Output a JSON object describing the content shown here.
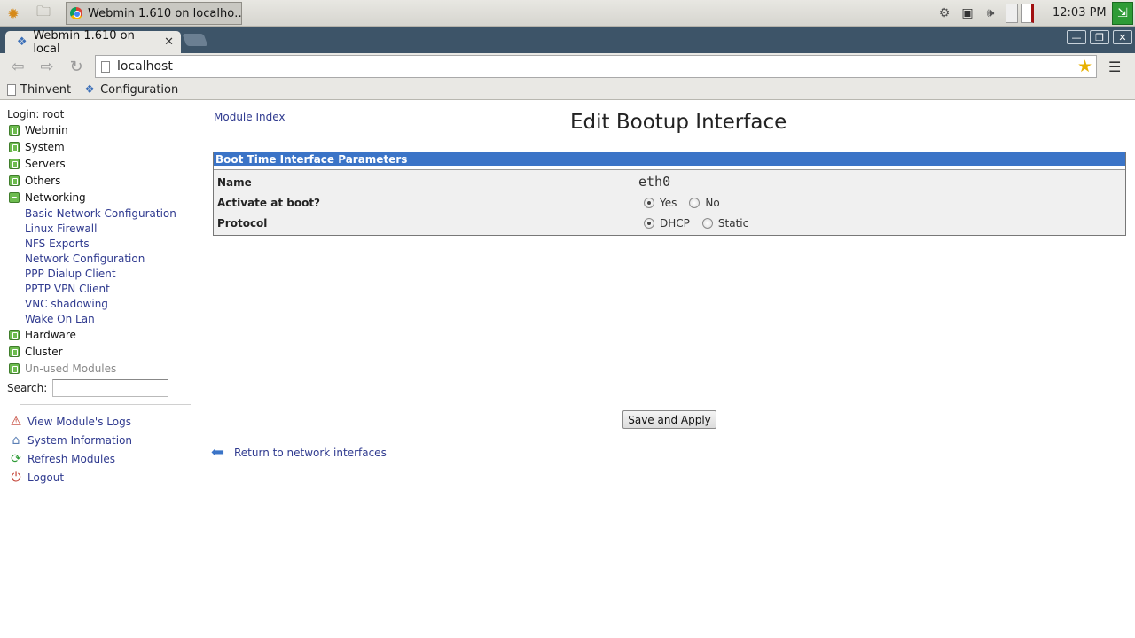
{
  "taskbar": {
    "active_window": "Webmin 1.610 on localho…",
    "clock": "12:03 PM"
  },
  "browser": {
    "tab_title": "Webmin 1.610 on local",
    "url": "localhost",
    "bookmarks": [
      "Thinvent",
      "Configuration"
    ]
  },
  "sidebar": {
    "login": "Login: root",
    "categories": {
      "webmin": "Webmin",
      "system": "System",
      "servers": "Servers",
      "others": "Others",
      "networking": "Networking",
      "hardware": "Hardware",
      "cluster": "Cluster",
      "unused": "Un-used Modules"
    },
    "modules": [
      "Basic Network Configuration",
      "Linux Firewall",
      "NFS Exports",
      "Network Configuration",
      "PPP Dialup Client",
      "PPTP VPN Client",
      "VNC shadowing",
      "Wake On Lan"
    ],
    "search_label": "Search:",
    "search_value": "",
    "actions": {
      "logs": "View Module's Logs",
      "sysinfo": "System Information",
      "refresh": "Refresh Modules",
      "logout": "Logout"
    }
  },
  "main": {
    "module_index": "Module Index",
    "title": "Edit Bootup Interface",
    "table_header": "Boot Time Interface Parameters",
    "fields": {
      "name_label": "Name",
      "name_value": "eth0",
      "activate_label": "Activate at boot?",
      "activate_options": [
        "Yes",
        "No"
      ],
      "activate_selected": "Yes",
      "protocol_label": "Protocol",
      "protocol_options": [
        "DHCP",
        "Static"
      ],
      "protocol_selected": "DHCP"
    },
    "save_button": "Save and Apply",
    "return_link": "Return to network interfaces"
  }
}
